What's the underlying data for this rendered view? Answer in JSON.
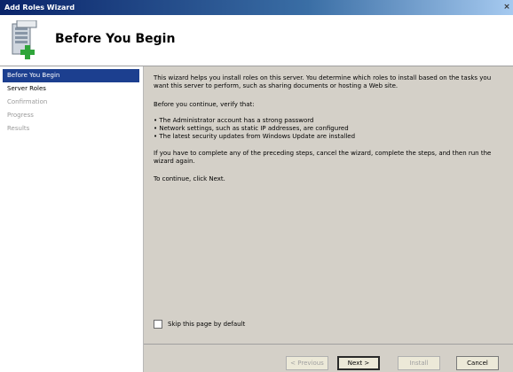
{
  "window": {
    "title": "Add Roles Wizard",
    "close_glyph": "×"
  },
  "header": {
    "title": "Before You Begin",
    "icon": "server-roles-icon"
  },
  "nav": {
    "items": [
      {
        "label": "Before You Begin",
        "state": "active"
      },
      {
        "label": "Server Roles",
        "state": "enabled"
      },
      {
        "label": "Confirmation",
        "state": "disabled"
      },
      {
        "label": "Progress",
        "state": "disabled"
      },
      {
        "label": "Results",
        "state": "disabled"
      }
    ]
  },
  "content": {
    "intro": "This wizard helps you install roles on this server. You determine which roles to install based on the tasks you want this server to perform, such as sharing documents or hosting a Web site.",
    "verify": "Before you continue, verify that:",
    "bullets": [
      "• The Administrator account has a strong password",
      "• Network settings, such as static IP addresses, are configured",
      "• The latest security updates from Windows Update are installed"
    ],
    "cancel_note": "If you have to complete any of the preceding steps, cancel the wizard, complete the steps, and then run the wizard again.",
    "continue_note": "To continue, click Next.",
    "skip_label": "Skip this page by default"
  },
  "footer": {
    "previous": "< Previous",
    "next": "Next >",
    "install": "Install",
    "cancel": "Cancel"
  },
  "colors": {
    "nav_active": "#1c3f8f",
    "panel": "#d4d0c8",
    "titlebar": "#0a246a"
  }
}
